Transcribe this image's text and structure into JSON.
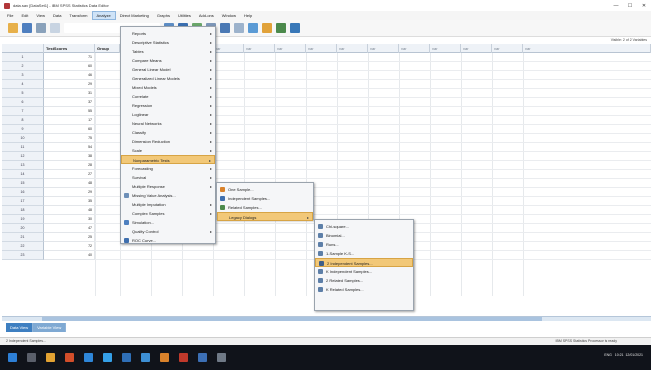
{
  "window": {
    "title": "data.sav [DataSet1] - IBM SPSS Statistics Data Editor",
    "controls": [
      "—",
      "☐",
      "✕"
    ]
  },
  "menubar": [
    "File",
    "Edit",
    "View",
    "Data",
    "Transform",
    "Analyze",
    "Direct Marketing",
    "Graphs",
    "Utilities",
    "Add-ons",
    "Window",
    "Help"
  ],
  "active_menu_index": 5,
  "visible_label": "Visible: 2 of 2 Variables",
  "grid": {
    "column_headers": [
      "TestScores",
      "Group",
      "var",
      "var",
      "var",
      "var",
      "var",
      "var",
      "var",
      "var",
      "var",
      "var",
      "var",
      "var",
      "var",
      "var"
    ],
    "rows": [
      {
        "num": "1",
        "score": "71"
      },
      {
        "num": "2",
        "score": "60"
      },
      {
        "num": "3",
        "score": "46"
      },
      {
        "num": "4",
        "score": "29"
      },
      {
        "num": "5",
        "score": "31"
      },
      {
        "num": "6",
        "score": "37"
      },
      {
        "num": "7",
        "score": "55"
      },
      {
        "num": "8",
        "score": "17"
      },
      {
        "num": "9",
        "score": "60"
      },
      {
        "num": "10",
        "score": "75"
      },
      {
        "num": "11",
        "score": "54"
      },
      {
        "num": "12",
        "score": "38"
      },
      {
        "num": "13",
        "score": "28"
      },
      {
        "num": "14",
        "score": "27"
      },
      {
        "num": "15",
        "score": "48"
      },
      {
        "num": "16",
        "score": "29"
      },
      {
        "num": "17",
        "score": "35"
      },
      {
        "num": "18",
        "score": "48"
      },
      {
        "num": "19",
        "score": "30"
      },
      {
        "num": "20",
        "score": "47"
      },
      {
        "num": "21",
        "score": "25"
      },
      {
        "num": "22",
        "score": "72"
      },
      {
        "num": "23",
        "score": "40"
      }
    ]
  },
  "analyze_menu": [
    {
      "label": "Reports",
      "sub": true
    },
    {
      "label": "Descriptive Statistics",
      "sub": true
    },
    {
      "label": "Tables",
      "sub": true
    },
    {
      "label": "Compare Means",
      "sub": true
    },
    {
      "label": "General Linear Model",
      "sub": true
    },
    {
      "label": "Generalized Linear Models",
      "sub": true
    },
    {
      "label": "Mixed Models",
      "sub": true
    },
    {
      "label": "Correlate",
      "sub": true
    },
    {
      "label": "Regression",
      "sub": true
    },
    {
      "label": "Loglinear",
      "sub": true
    },
    {
      "label": "Neural Networks",
      "sub": true
    },
    {
      "label": "Classify",
      "sub": true
    },
    {
      "label": "Dimension Reduction",
      "sub": true
    },
    {
      "label": "Scale",
      "sub": true
    },
    {
      "label": "Nonparametric Tests",
      "sub": true,
      "highlight": true
    },
    {
      "label": "Forecasting",
      "sub": true
    },
    {
      "label": "Survival",
      "sub": true
    },
    {
      "label": "Multiple Response",
      "sub": true
    },
    {
      "label": "Missing Value Analysis...",
      "sub": false
    },
    {
      "label": "Multiple Imputation",
      "sub": true
    },
    {
      "label": "Complex Samples",
      "sub": true
    },
    {
      "label": "Simulation...",
      "sub": false
    },
    {
      "label": "Quality Control",
      "sub": true
    },
    {
      "label": "ROC Curve...",
      "sub": false
    }
  ],
  "nonparam_menu": [
    {
      "label": "One Sample...",
      "sub": false
    },
    {
      "label": "Independent Samples...",
      "sub": false
    },
    {
      "label": "Related Samples...",
      "sub": false
    },
    {
      "label": "Legacy Dialogs",
      "sub": true,
      "highlight": true
    }
  ],
  "legacy_menu": [
    {
      "label": "Chi-square...",
      "highlight": false
    },
    {
      "label": "Binomial...",
      "highlight": false
    },
    {
      "label": "Runs...",
      "highlight": false
    },
    {
      "label": "1-Sample K-S...",
      "highlight": false
    },
    {
      "label": "2 Independent Samples...",
      "highlight": true
    },
    {
      "label": "K Independent Samples...",
      "highlight": false
    },
    {
      "label": "2 Related Samples...",
      "highlight": false
    },
    {
      "label": "K Related Samples...",
      "highlight": false
    }
  ],
  "view_tabs": [
    "Data View",
    "Variable View"
  ],
  "statusbar": {
    "left": "2 Independent Samples...",
    "right": "IBM SPSS Statistics Processor is ready"
  },
  "tray": {
    "lang": "ENG",
    "time": "10:21",
    "date": "12/01/2021"
  },
  "colors": {
    "accent": "#3e7fc1",
    "highlight": "#f2c878",
    "taskbar": "#10131a"
  }
}
